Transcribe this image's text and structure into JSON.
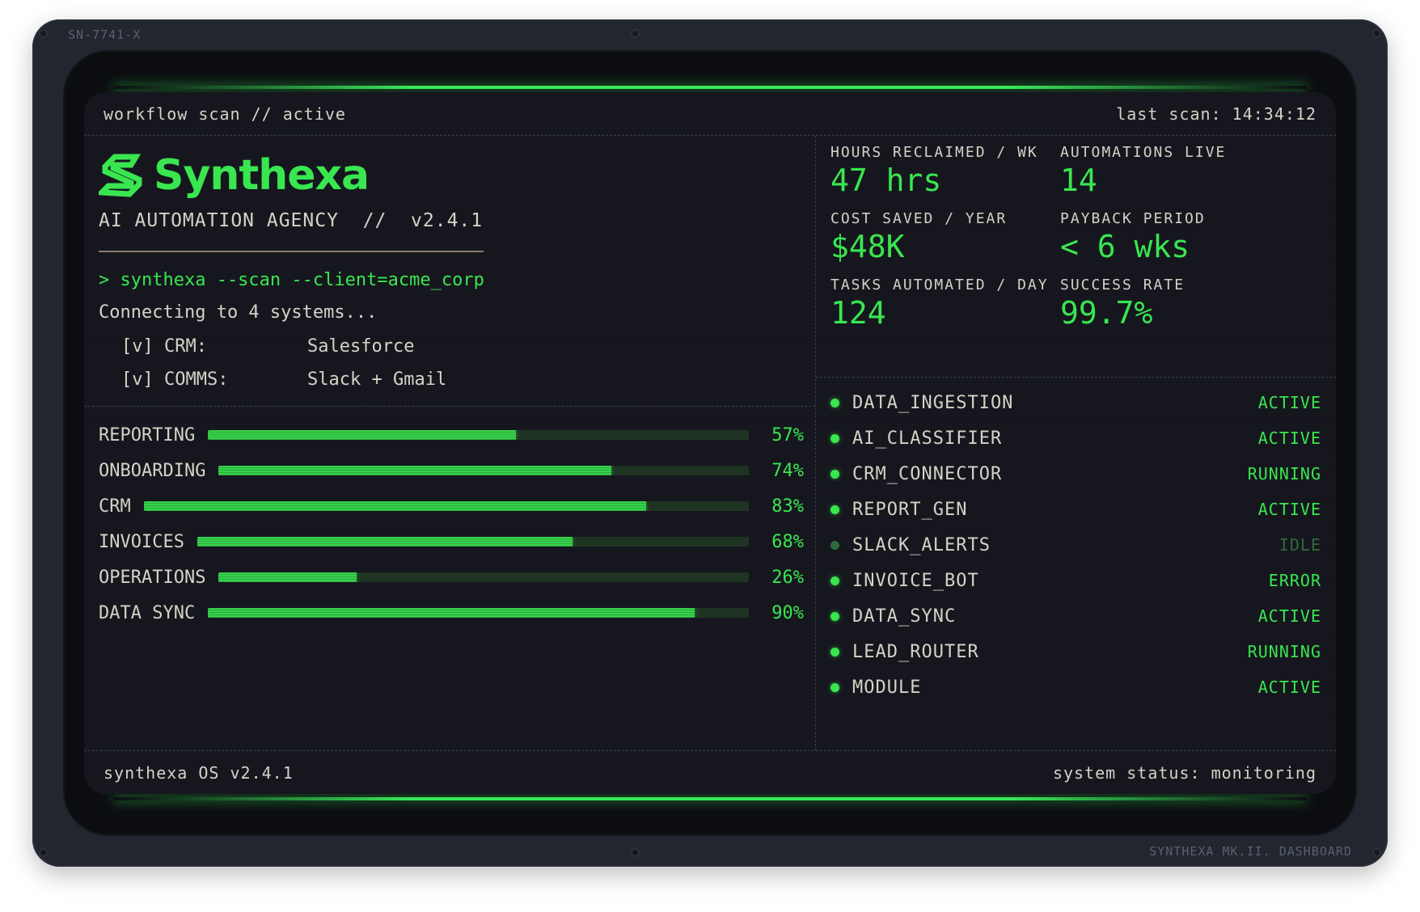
{
  "device": {
    "serial": "SN-7741-X",
    "model": "SYNTHEXA MK.II. DASHBOARD"
  },
  "header": {
    "left": "workflow scan // active",
    "right": "last scan: 14:34:12"
  },
  "footer": {
    "left": "synthexa OS v2.4.1",
    "right": "system status: monitoring"
  },
  "brand": {
    "name": "Synthexa",
    "tagline": "AI AUTOMATION AGENCY  //  v2.4.1",
    "logo_icon": "s-logo-icon",
    "accent_color": "#39e650"
  },
  "terminal": {
    "command": "> synthexa --scan --client=acme_corp",
    "status": "Connecting to 4 systems...",
    "systems": [
      {
        "key": "[v] CRM:",
        "value": "Salesforce"
      },
      {
        "key": "[v] COMMS:",
        "value": "Slack + Gmail"
      }
    ]
  },
  "progress": [
    {
      "label": "REPORTING",
      "pct_text": "57%",
      "value": 0.57
    },
    {
      "label": "ONBOARDING",
      "pct_text": "74%",
      "value": 0.74
    },
    {
      "label": "CRM",
      "pct_text": "83%",
      "value": 0.83
    },
    {
      "label": "INVOICES",
      "pct_text": "68%",
      "value": 0.68
    },
    {
      "label": "OPERATIONS",
      "pct_text": "26%",
      "value": 0.26
    },
    {
      "label": "DATA SYNC",
      "pct_text": "90%",
      "value": 0.9
    }
  ],
  "metrics": [
    {
      "label": "HOURS RECLAIMED / WK",
      "value": "47 hrs"
    },
    {
      "label": "AUTOMATIONS LIVE",
      "value": "14"
    },
    {
      "label": "COST SAVED / YEAR",
      "value": "$48K"
    },
    {
      "label": "PAYBACK PERIOD",
      "value": "< 6 wks"
    },
    {
      "label": "TASKS AUTOMATED / DAY",
      "value": "124"
    },
    {
      "label": "SUCCESS RATE",
      "value": "99.7%"
    }
  ],
  "modules": [
    {
      "name": "DATA_INGESTION",
      "status": "ACTIVE"
    },
    {
      "name": "AI_CLASSIFIER",
      "status": "ACTIVE"
    },
    {
      "name": "CRM_CONNECTOR",
      "status": "RUNNING"
    },
    {
      "name": "REPORT_GEN",
      "status": "ACTIVE"
    },
    {
      "name": "SLACK_ALERTS",
      "status": "IDLE"
    },
    {
      "name": "INVOICE_BOT",
      "status": "ERROR"
    },
    {
      "name": "DATA_SYNC",
      "status": "ACTIVE"
    },
    {
      "name": "LEAD_ROUTER",
      "status": "RUNNING"
    },
    {
      "name": "MODULE",
      "status": "ACTIVE"
    }
  ]
}
